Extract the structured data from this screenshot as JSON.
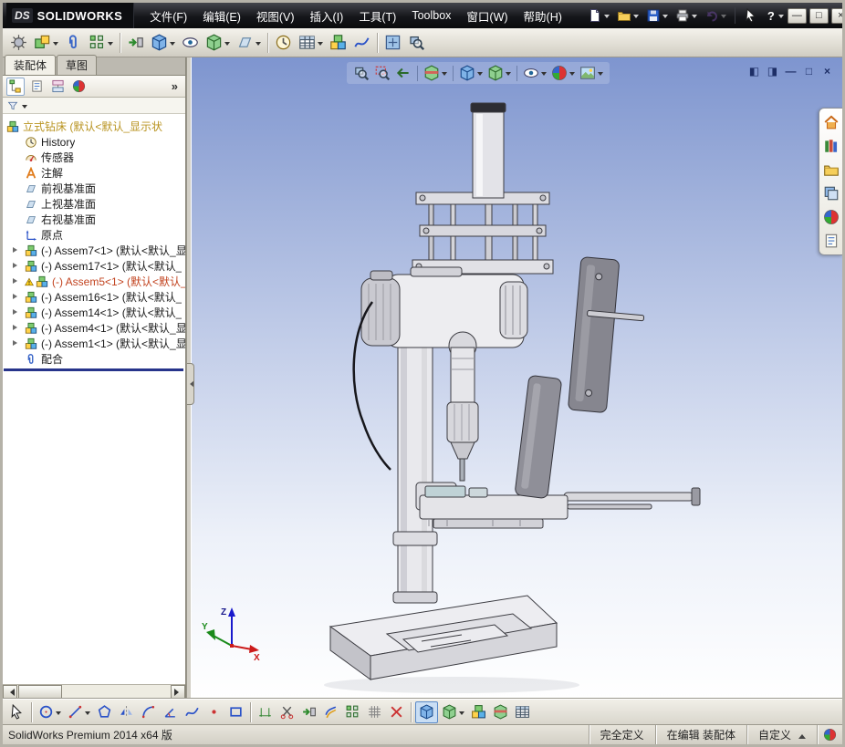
{
  "titlebar": {
    "logo_mark": "DS",
    "logo_text": "SOLIDWORKS",
    "menus": [
      "文件(F)",
      "编辑(E)",
      "视图(V)",
      "插入(I)",
      "工具(T)",
      "Toolbox",
      "窗口(W)",
      "帮助(H)"
    ],
    "help_glyph": "?",
    "window_buttons": {
      "minimize": "—",
      "maximize": "□",
      "close": "×"
    }
  },
  "panel": {
    "tabs": [
      {
        "label": "装配体"
      },
      {
        "label": "草图"
      }
    ],
    "overflow_glyph": "»"
  },
  "feature_tree": {
    "items": [
      {
        "label": "立式钻床 (默认<默认_显示状"
      },
      {
        "label": "History"
      },
      {
        "label": "传感器"
      },
      {
        "label": "注解"
      },
      {
        "label": "前视基准面"
      },
      {
        "label": "上视基准面"
      },
      {
        "label": "右视基准面"
      },
      {
        "label": "原点"
      },
      {
        "label": "(-) Assem7<1> (默认<默认_显"
      },
      {
        "label": "(-) Assem17<1> (默认<默认_"
      },
      {
        "label": "(-) Assem5<1> (默认<默认_"
      },
      {
        "label": "(-) Assem16<1> (默认<默认_"
      },
      {
        "label": "(-) Assem14<1> (默认<默认_"
      },
      {
        "label": "(-) Assem4<1> (默认<默认_显"
      },
      {
        "label": "(-) Assem1<1> (默认<默认_显"
      },
      {
        "label": "配合"
      }
    ]
  },
  "viewport": {
    "doc_controls": [
      "◧",
      "◨",
      "—",
      "□",
      "×"
    ],
    "triad": {
      "x": "X",
      "y": "Y",
      "z": "Z"
    }
  },
  "statusbar": {
    "left": "SolidWorks Premium 2014 x64 版",
    "defined": "完全定义",
    "editing": "在编辑 装配体",
    "custom": "自定义"
  },
  "colors": {
    "root_text": "#b8931f",
    "warning_text": "#c2431f",
    "endbar": "#27348b",
    "viewport_top": "#7e95cf"
  }
}
